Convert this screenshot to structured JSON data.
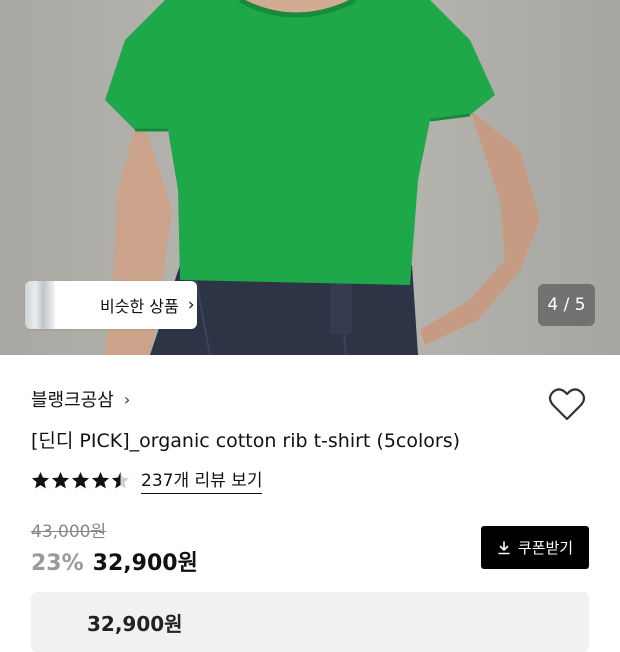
{
  "gallery": {
    "similar_label": "비슷한 상품",
    "counter": "4 / 5"
  },
  "product": {
    "brand": "블랭크공삼",
    "title": "[딘디 PICK]_organic cotton rib t-shirt (5colors)",
    "rating": 4.5,
    "review_link": "237개 리뷰 보기",
    "original_price": "43,000원",
    "discount": "23%",
    "sale_price": "32,900원",
    "coupon_label": "쿠폰받기",
    "bottom_card_text": "32,900원"
  },
  "icons": [
    "chevron-right-icon",
    "heart-icon",
    "star-icon",
    "half-star-icon",
    "download-icon"
  ],
  "colors": {
    "shirt_green": "#1fa84a",
    "coupon_bg": "#000000",
    "muted": "#9a9a9a"
  }
}
